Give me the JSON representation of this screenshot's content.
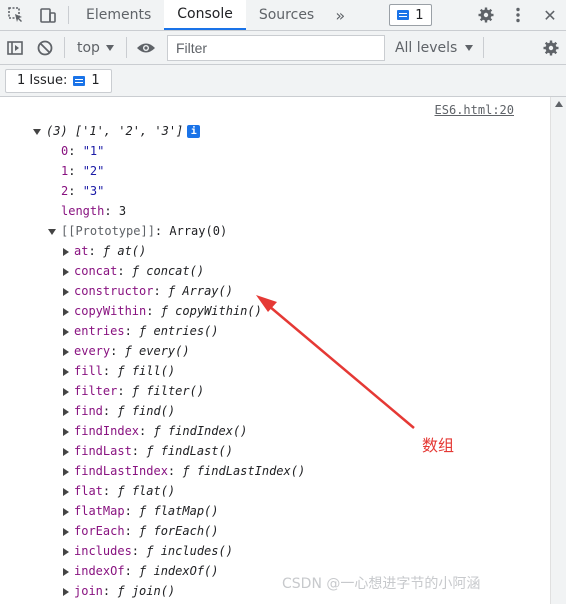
{
  "tabbar": {
    "inspect_icon": "inspect-element-icon",
    "device_icon": "device-toolbar-icon",
    "tabs": [
      "Elements",
      "Console",
      "Sources"
    ],
    "more_label": "»",
    "issues_count": "1",
    "settings_icon": "gear-icon",
    "menu_icon": "kebab-menu-icon",
    "close_label": "✕"
  },
  "toolbar": {
    "sidebar_icon": "show-sidebar-icon",
    "clear_icon": "clear-console-icon",
    "context": "top",
    "eye_icon": "live-expression-icon",
    "filter_placeholder": "Filter",
    "levels_label": "All levels",
    "settings_icon": "gear-icon"
  },
  "issues_bar": {
    "label": "1 Issue:",
    "count": "1"
  },
  "console": {
    "source_link": "ES6.html:20",
    "summary": "(3) ['1', '2', '3']",
    "info_badge": "i",
    "items": [
      {
        "key": "0",
        "value": "\"1\""
      },
      {
        "key": "1",
        "value": "\"2\""
      },
      {
        "key": "2",
        "value": "\"3\""
      }
    ],
    "length_key": "length",
    "length_value": "3",
    "prototype_key": "[[Prototype]]",
    "prototype_value": "Array(0)",
    "methods": [
      {
        "key": "at",
        "fn": "at()"
      },
      {
        "key": "concat",
        "fn": "concat()"
      },
      {
        "key": "constructor",
        "fn": "Array()"
      },
      {
        "key": "copyWithin",
        "fn": "copyWithin()"
      },
      {
        "key": "entries",
        "fn": "entries()"
      },
      {
        "key": "every",
        "fn": "every()"
      },
      {
        "key": "fill",
        "fn": "fill()"
      },
      {
        "key": "filter",
        "fn": "filter()"
      },
      {
        "key": "find",
        "fn": "find()"
      },
      {
        "key": "findIndex",
        "fn": "findIndex()"
      },
      {
        "key": "findLast",
        "fn": "findLast()"
      },
      {
        "key": "findLastIndex",
        "fn": "findLastIndex()"
      },
      {
        "key": "flat",
        "fn": "flat()"
      },
      {
        "key": "flatMap",
        "fn": "flatMap()"
      },
      {
        "key": "forEach",
        "fn": "forEach()"
      },
      {
        "key": "includes",
        "fn": "includes()"
      },
      {
        "key": "indexOf",
        "fn": "indexOf()"
      },
      {
        "key": "join",
        "fn": "join()"
      }
    ]
  },
  "annotation": {
    "label": "数组",
    "arrow_color": "#e53935"
  },
  "watermark": "CSDN @一心想进字节的小阿涵",
  "colors": {
    "accent": "#1a73e8",
    "property_key": "#881280",
    "string_value": "#1a1aa6"
  }
}
